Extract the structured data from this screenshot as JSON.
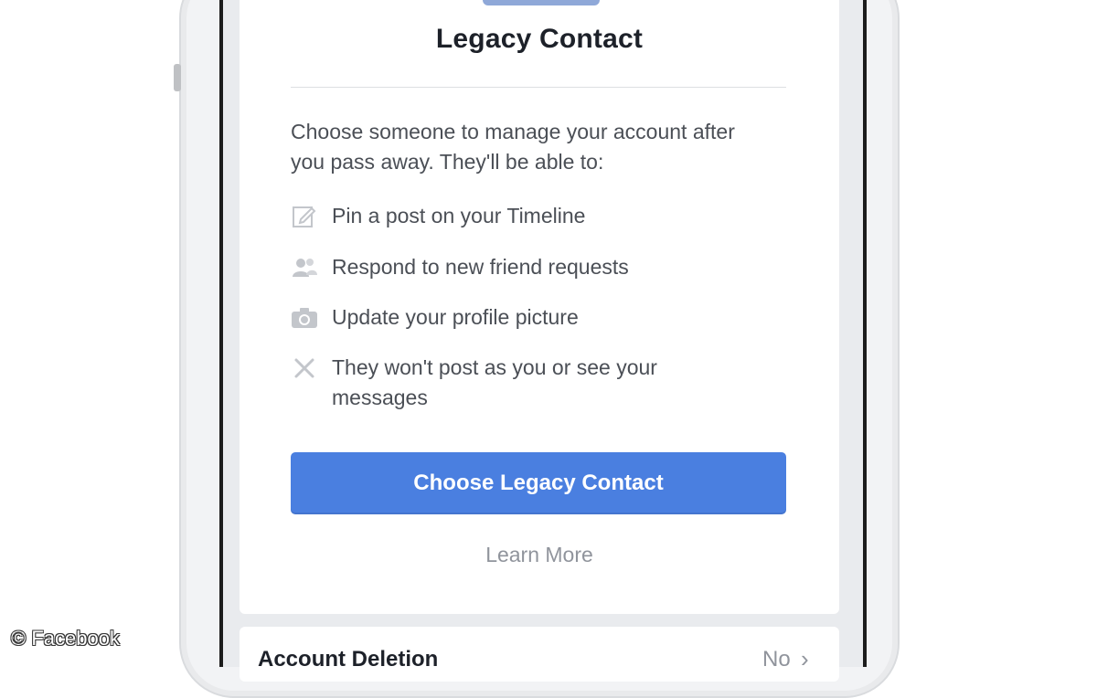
{
  "card": {
    "title": "Legacy Contact",
    "intro": "Choose someone to manage your account after you pass away. They'll be able to:",
    "abilities": [
      {
        "icon": "pencil-icon",
        "text": "Pin a post on your Timeline"
      },
      {
        "icon": "friends-icon",
        "text": "Respond to new friend requests"
      },
      {
        "icon": "camera-icon",
        "text": "Update your profile picture"
      },
      {
        "icon": "x-icon",
        "text": "They won't post as you or see your messages"
      }
    ],
    "primary_button": "Choose Legacy Contact",
    "learn_more": "Learn More"
  },
  "account_deletion": {
    "title": "Account Deletion",
    "value": "No"
  },
  "watermark": "© Facebook",
  "colors": {
    "button": "#4a7fe0",
    "icon_gray": "#c3c6cb",
    "text_gray": "#4b4f56",
    "link_gray": "#90949c"
  }
}
